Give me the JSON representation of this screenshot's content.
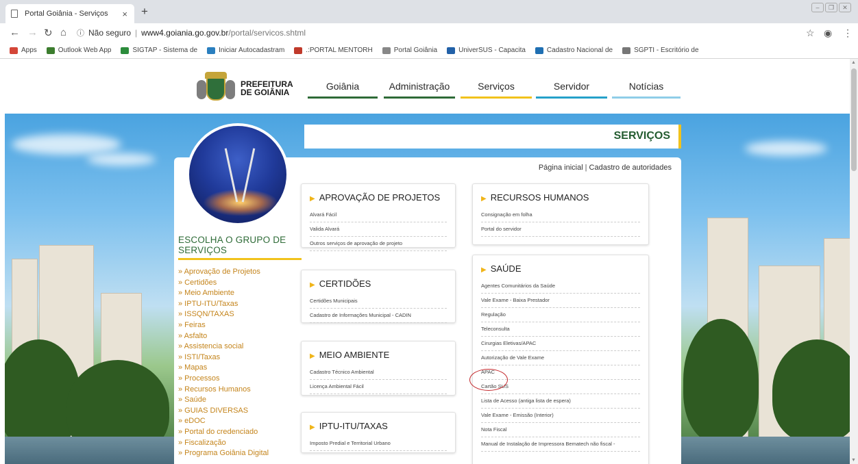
{
  "browser": {
    "tab_title": "Portal Goiânia - Serviços",
    "tab_close": "×",
    "new_tab": "+",
    "not_secure": "Não seguro",
    "url_host": "www4.goiania.go.gov.br",
    "url_path": "/portal/servicos.shtml",
    "bookmarks": [
      {
        "label": "Apps",
        "color": "#d44638"
      },
      {
        "label": "Outlook Web App",
        "color": "#3c7d2e"
      },
      {
        "label": "SIGTAP - Sistema de",
        "color": "#2c8c3c"
      },
      {
        "label": "Iniciar Autocadastram",
        "color": "#2a7fbf"
      },
      {
        "label": ".:PORTAL MENTORH",
        "color": "#c03a2b"
      },
      {
        "label": "Portal Goiânia",
        "color": "#888888"
      },
      {
        "label": "UniverSUS - Capacita",
        "color": "#2261a8"
      },
      {
        "label": "Cadastro Nacional de",
        "color": "#1f6fb2"
      },
      {
        "label": "SGPTI - Escritório de",
        "color": "#777777"
      }
    ]
  },
  "header": {
    "logo_line1": "PREFEITURA",
    "logo_line2": "DE GOIÂNIA",
    "nav": [
      {
        "label": "Goiânia",
        "color": "#2e6b37"
      },
      {
        "label": "Administração",
        "color": "#2e6b37"
      },
      {
        "label": "Serviços",
        "color": "#f1c21b"
      },
      {
        "label": "Servidor",
        "color": "#25a0c9"
      },
      {
        "label": "Notícias",
        "color": "#8fcde8"
      }
    ]
  },
  "page": {
    "banner_title": "SERVIÇOS",
    "link_home": "Página inicial",
    "link_authorities": "Cadastro de autoridades",
    "choose_group_title": "ESCOLHA O GRUPO DE SERVIÇOS",
    "groups": [
      "» Aprovação de Projetos",
      "» Certidões",
      "» Meio Ambiente",
      "» IPTU-ITU/Taxas",
      "» ISSQN/TAXAS",
      "» Feiras",
      "» Asfalto",
      "» Assistencia social",
      "» ISTI/Taxas",
      "» Mapas",
      "» Processos",
      "» Recursos Humanos",
      "» Saúde",
      "» GUIAS DIVERSAS",
      "» eDOC",
      "» Portal do credenciado",
      "» Fiscalização",
      "» Programa Goiânia Digital"
    ],
    "boxes": {
      "aprovacao": {
        "title": "APROVAÇÃO DE PROJETOS",
        "items": [
          "Alvará Fácil",
          "Valida Alvará",
          "Outros serviços de aprovação de projeto"
        ]
      },
      "certidoes": {
        "title": "CERTIDÕES",
        "items": [
          "Certidões Municipais",
          "Cadastro de Informações Municipal - CADIN"
        ]
      },
      "meio_ambiente": {
        "title": "MEIO AMBIENTE",
        "items": [
          "Cadastro Técnico Ambiental",
          "Licença Ambiental Fácil"
        ]
      },
      "iptu": {
        "title": "IPTU-ITU/TAXAS",
        "items": [
          "Imposto Predial e Territorial Urbano"
        ]
      },
      "rh": {
        "title": "RECURSOS HUMANOS",
        "items": [
          "Consignação em folha",
          "Portal do servidor"
        ]
      },
      "saude": {
        "title": "SAÚDE",
        "items": [
          "Agentes Comunitários da Saúde",
          "Vale Exame - Baixa Prestador",
          "Regulação",
          "Teleconsulta",
          "Cirurgias Eletivas/APAC",
          "Autorização de Vale Exame",
          "APAC",
          "Cartão SUS",
          "Lista de Acesso (antiga lista de espera)",
          "Vale Exame - Emissão (Interior)",
          "Nota Fiscal",
          "Manual de Instalação de Impressora Bematech não fiscal -"
        ]
      }
    }
  }
}
